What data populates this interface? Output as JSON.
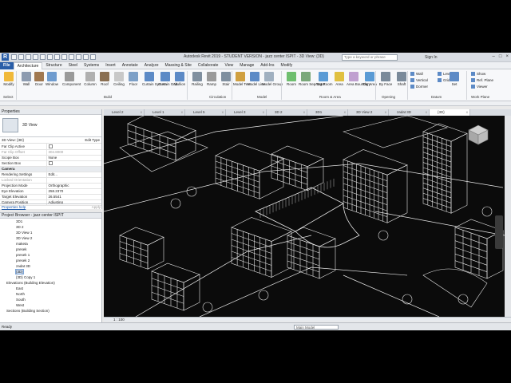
{
  "window": {
    "title": "Autodesk Revit 2019 - STUDENT VERSION - jazz center ISPIT - 3D View: {3D}",
    "search_placeholder": "Type a keyword or phrase",
    "signin_label": "Sign In",
    "app_logo": "R"
  },
  "ribbon_tabs": [
    "File",
    "Architecture",
    "Structure",
    "Steel",
    "Systems",
    "Insert",
    "Annotate",
    "Analyze",
    "Massing & Site",
    "Collaborate",
    "View",
    "Manage",
    "Add-Ins",
    "Modify"
  ],
  "ribbon": {
    "tools": [
      "Modify",
      "Wall",
      "Door",
      "Window",
      "Component",
      "Column",
      "Roof",
      "Ceiling",
      "Floor",
      "Curtain System",
      "Curtain Grid",
      "Mullion",
      "Railing",
      "Ramp",
      "Stair",
      "Model Text",
      "Model Line",
      "Model Group",
      "Room",
      "Room Separator",
      "Tag Room",
      "Area",
      "Area Boundary",
      "Tag Area",
      "By Face",
      "Shaft",
      "Set"
    ],
    "panels": [
      "Select",
      "Build",
      "Circulation",
      "Model",
      "Room & Area",
      "Opening",
      "Datum",
      "Work Plane"
    ],
    "side_tools": [
      "Wall",
      "Vertical",
      "Dormer",
      "Level",
      "Grid",
      "Show",
      "Ref. Plane",
      "Viewer"
    ]
  },
  "properties": {
    "header": "Properties",
    "type_name": "3D View",
    "instance_label": "3D View: {3D}",
    "edit_type": "Edit Type",
    "rows": [
      {
        "k": "Far Clip Active",
        "v": "",
        "kind": "check"
      },
      {
        "k": "Far Clip Offset",
        "v": "304.8000",
        "kind": "grey"
      },
      {
        "k": "Scope Box",
        "v": "None",
        "kind": "plain"
      },
      {
        "k": "Section Box",
        "v": "",
        "kind": "check"
      },
      {
        "k": "Camera",
        "v": "",
        "kind": "group"
      },
      {
        "k": "Rendering Settings",
        "v": "Edit...",
        "kind": "plain"
      },
      {
        "k": "Locked Orientation",
        "v": "",
        "kind": "grey"
      },
      {
        "k": "Projection Mode",
        "v": "Orthographic",
        "kind": "plain"
      },
      {
        "k": "Eye Elevation",
        "v": "258.2370",
        "kind": "plain"
      },
      {
        "k": "Target Elevation",
        "v": "26.5541",
        "kind": "plain"
      },
      {
        "k": "Camera Position",
        "v": "Adjusting",
        "kind": "plain"
      }
    ],
    "help_link": "Properties help",
    "apply": "Apply"
  },
  "browser": {
    "header": "Project Browser - jazz center ISPIT",
    "items": [
      "3D1",
      "3D 2",
      "3D View 1",
      "3D View 2",
      "maketa",
      "presek",
      "presek 1",
      "presek 2",
      "zadat 3D",
      "{3D}",
      "{3D} Copy 1",
      "Elevations (Building Elevation)",
      "East",
      "North",
      "South",
      "West",
      "Sections (Building Section)"
    ]
  },
  "view_tabs": [
    "Level 2",
    "Level 1",
    "Level 5",
    "Level 3",
    "3D 2",
    "3D1",
    "3D View 2",
    "zadat 3D",
    "{3D}"
  ],
  "active_view_tab": "{3D}",
  "view_control": {
    "scale": "1 : 100"
  },
  "status": {
    "ready": "Ready",
    "model": "Main Model"
  },
  "colors": {
    "accent": "#2a5ea8",
    "canvas": "#0b0b0b",
    "wireframe": "#e8e8e8"
  },
  "icons": [
    "revit-logo-icon",
    "viewcube-icon",
    "navigation-bar-icon",
    "watermark-logo-icon"
  ]
}
